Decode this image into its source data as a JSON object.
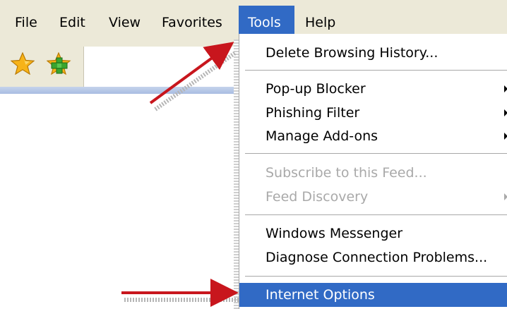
{
  "menubar": {
    "items": [
      "File",
      "Edit",
      "View",
      "Favorites",
      "Tools",
      "Help"
    ],
    "active": "Tools"
  },
  "toolbar": {
    "icons": [
      "favorites-star-icon",
      "add-favorite-icon"
    ]
  },
  "dropdown": {
    "items": [
      {
        "label": "Delete Browsing History...",
        "enabled": true
      },
      {
        "label": "Pop-up Blocker",
        "enabled": true,
        "submenu": true
      },
      {
        "label": "Phishing Filter",
        "enabled": true,
        "submenu": true
      },
      {
        "label": "Manage Add-ons",
        "enabled": true,
        "submenu": true
      },
      {
        "label": "Subscribe to this Feed...",
        "enabled": false
      },
      {
        "label": "Feed Discovery",
        "enabled": false,
        "submenu": true
      },
      {
        "label": "Windows Messenger",
        "enabled": true
      },
      {
        "label": "Diagnose Connection Problems...",
        "enabled": true
      },
      {
        "label": "Internet Options",
        "enabled": true,
        "selected": true
      }
    ]
  },
  "colors": {
    "menu_highlight": "#316ac5",
    "annotation_arrow": "#c8161d",
    "menubar_bg": "#ece9d8"
  }
}
